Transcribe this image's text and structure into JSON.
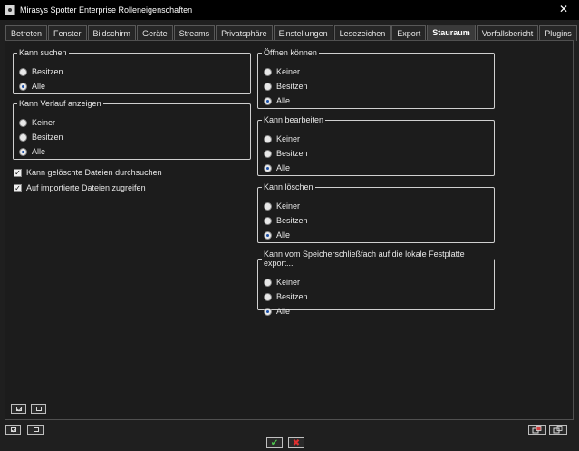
{
  "window": {
    "title": "Mirasys Spotter Enterprise Rolleneigenschaften",
    "close_glyph": "✕"
  },
  "tabs": [
    {
      "label": "Betreten"
    },
    {
      "label": "Fenster"
    },
    {
      "label": "Bildschirm"
    },
    {
      "label": "Geräte"
    },
    {
      "label": "Streams"
    },
    {
      "label": "Privatsphäre"
    },
    {
      "label": "Einstellungen"
    },
    {
      "label": "Lesezeichen"
    },
    {
      "label": "Export"
    },
    {
      "label": "Stauraum",
      "active": true
    },
    {
      "label": "Vorfallsbericht"
    },
    {
      "label": "Plugins"
    }
  ],
  "groups": {
    "search": {
      "legend": "Kann suchen",
      "options": [
        "Besitzen",
        "Alle"
      ],
      "selected": "Alle"
    },
    "history": {
      "legend": "Kann Verlauf anzeigen",
      "options": [
        "Keiner",
        "Besitzen",
        "Alle"
      ],
      "selected": "Alle"
    },
    "open": {
      "legend": "Öffnen können",
      "options": [
        "Keiner",
        "Besitzen",
        "Alle"
      ],
      "selected": "Alle"
    },
    "edit": {
      "legend": "Kann bearbeiten",
      "options": [
        "Keiner",
        "Besitzen",
        "Alle"
      ],
      "selected": "Alle"
    },
    "delete": {
      "legend": "Kann löschen",
      "options": [
        "Keiner",
        "Besitzen",
        "Alle"
      ],
      "selected": "Alle"
    },
    "export_local": {
      "legend": "Kann vom Speicherschließfach auf die lokale Festplatte export...",
      "options": [
        "Keiner",
        "Besitzen",
        "Alle"
      ],
      "selected": "Alle"
    }
  },
  "checkboxes": {
    "search_deleted": {
      "label": "Kann gelöschte Dateien durchsuchen",
      "checked": true
    },
    "access_imported": {
      "label": "Auf importierte Dateien zugreifen",
      "checked": true
    }
  },
  "icons": {
    "app": "app-icon",
    "close": "close-icon",
    "ok": "✔",
    "cancel": "✖",
    "check": "✓"
  },
  "colors": {
    "background": "#1c1c1c",
    "titlebar": "#000000",
    "ok": "#4cc24c",
    "cancel": "#e03030",
    "radio_dot": "#1a4fa8"
  }
}
